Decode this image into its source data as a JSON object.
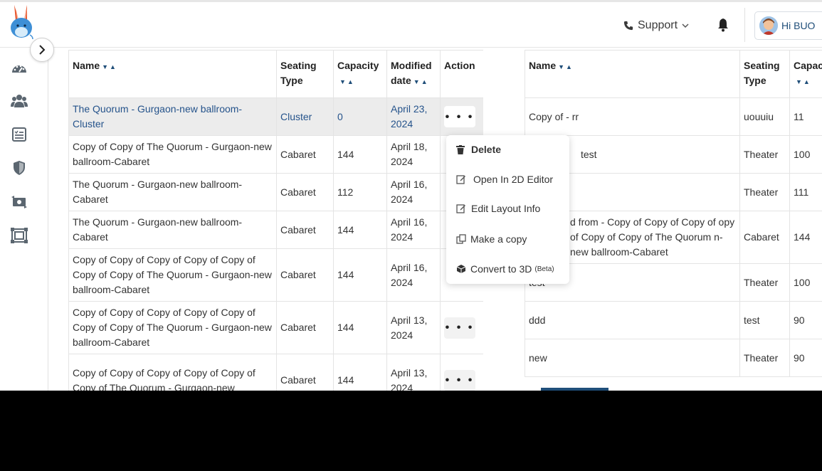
{
  "header": {
    "support_label": "Support",
    "greeting": "Hi BUO"
  },
  "left_table": {
    "columns": [
      "Name",
      "Seating Type",
      "Capacity",
      "Modified date",
      "Action"
    ],
    "rows": [
      {
        "name": "The Quorum - Gurgaon-new ballroom-Cluster",
        "seating": "Cluster",
        "capacity": "0",
        "modified": "April 23, 2024"
      },
      {
        "name": "Copy of Copy of The Quorum - Gurgaon-new ballroom-Cabaret",
        "seating": "Cabaret",
        "capacity": "144",
        "modified": "April 18, 2024"
      },
      {
        "name": "The Quorum - Gurgaon-new ballroom-Cabaret",
        "seating": "Cabaret",
        "capacity": "112",
        "modified": "April 16, 2024"
      },
      {
        "name": "The Quorum - Gurgaon-new ballroom-Cabaret",
        "seating": "Cabaret",
        "capacity": "144",
        "modified": "April 16, 2024"
      },
      {
        "name": "Copy of Copy of Copy of Copy of Copy of Copy of Copy of The Quorum - Gurgaon-new ballroom-Cabaret",
        "seating": "Cabaret",
        "capacity": "144",
        "modified": "April 16, 2024"
      },
      {
        "name": "Copy of Copy of Copy of Copy of Copy of Copy of Copy of The Quorum - Gurgaon-new ballroom-Cabaret",
        "seating": "Cabaret",
        "capacity": "144",
        "modified": "April 13, 2024"
      },
      {
        "name": "Copy of Copy of Copy of Copy of Copy of Copy of The Quorum - Gurgaon-new",
        "seating": "Cabaret",
        "capacity": "144",
        "modified": "April 13, 2024"
      }
    ],
    "action_label": "• • •"
  },
  "right_table": {
    "columns": [
      "Name",
      "Seating Type",
      "Capac"
    ],
    "rows": [
      {
        "name": "Copy of - rr",
        "seating": "uouuiu",
        "capacity": "11"
      },
      {
        "name": "test",
        "seating": "Theater",
        "capacity": "100"
      },
      {
        "name": "",
        "seating": "Theater",
        "capacity": "111"
      },
      {
        "name": "d from - Copy of Copy of Copy of opy of Copy of Copy of The Quorum n-new ballroom-Cabaret",
        "seating": "Cabaret",
        "capacity": "144"
      },
      {
        "name": "test",
        "seating": "Theater",
        "capacity": "100"
      },
      {
        "name": "ddd",
        "seating": "test",
        "capacity": "90"
      },
      {
        "name": "new",
        "seating": "Theater",
        "capacity": "90"
      }
    ]
  },
  "action_menu": {
    "items": [
      "Delete",
      "Open In 2D Editor",
      "Edit Layout Info",
      "Make a copy",
      "Convert to 3D"
    ],
    "beta_label": "(Beta)"
  },
  "colors": {
    "accent": "#1f4e79",
    "link": "#25538b",
    "row_highlight": "#ececec"
  }
}
